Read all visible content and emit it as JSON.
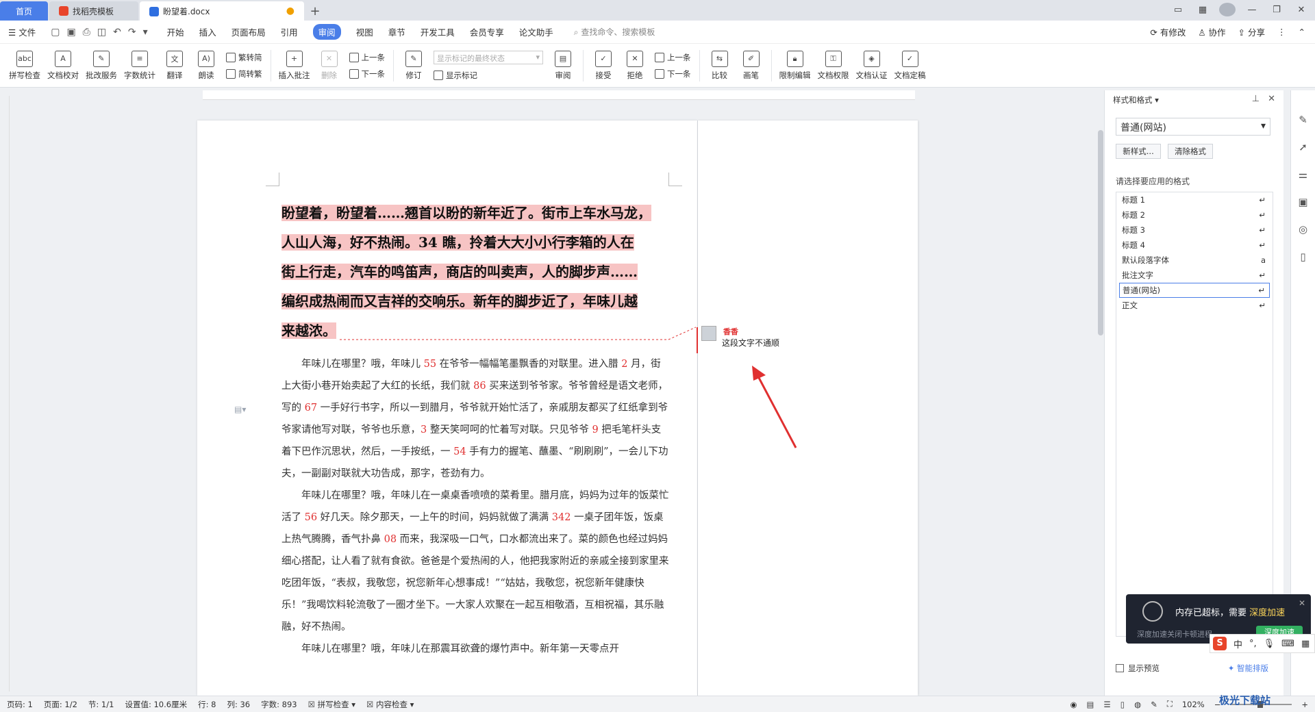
{
  "titlebar": {
    "tabs": [
      {
        "label": "首页"
      },
      {
        "label": "找稻壳模板"
      },
      {
        "label": "盼望着.docx"
      }
    ]
  },
  "menubar": {
    "file": "文件",
    "items": [
      "开始",
      "插入",
      "页面布局",
      "引用",
      "审阅",
      "视图",
      "章节",
      "开发工具",
      "会员专享",
      "论文助手"
    ],
    "active": "审阅",
    "search": "查找命令、搜索模板",
    "right": [
      "有修改",
      "协作",
      "分享"
    ]
  },
  "ribbon": {
    "spell": "拼写检查",
    "proof": "文档校对",
    "revise_service": "批改服务",
    "word_count": "字数统计",
    "translate": "翻译",
    "read_aloud": "朗读",
    "to_traditional": "繁转简",
    "to_simplified": "简转繁",
    "insert_comment": "插入批注",
    "delete": "删除",
    "prev": "上一条",
    "next": "下一条",
    "track": "修订",
    "markup_state": "显示标记的最终状态",
    "show_markup": "显示标记",
    "review": "审阅",
    "accept": "接受",
    "reject": "拒绝",
    "prev2": "上一条",
    "next2": "下一条",
    "compare": "比较",
    "ink": "画笔",
    "restrict": "限制编辑",
    "doc_perm": "文档权限",
    "doc_cert": "文档认证",
    "doc_final": "文档定稿"
  },
  "document": {
    "heading_lines": [
      "盼望着，盼望着……翘首以盼的新年近了。街市上车水马龙，",
      "人山人海，好不热闹。34 瞧，拎着大大小小行李箱的人在",
      "街上行走，汽车的鸣笛声，商店的叫卖声，人的脚步声……",
      "编织成热闹而又吉祥的交响乐。新年的脚步近了，年味儿越",
      "来越浓。"
    ],
    "paragraphs": [
      [
        {
          "t": "年味儿在哪里？哦，年味儿 "
        },
        {
          "n": "55"
        },
        {
          "t": " 在爷爷一幅幅笔墨飘香的对联里。进入腊 "
        },
        {
          "n": "2"
        },
        {
          "t": " 月，街上大街小巷开始卖起了大红的长纸，我们就 "
        },
        {
          "n": "86"
        },
        {
          "t": " 买来送到爷爷家。爷爷曾经是语文老师，写的 "
        },
        {
          "n": "67"
        },
        {
          "t": " 一手好行书字，所以一到腊月，爷爷就开始忙活了，亲戚朋友都买了红纸拿到爷爷家请他写对联，爷爷也乐意，"
        },
        {
          "n": "3"
        },
        {
          "t": " 整天笑呵呵的忙着写对联。只见爷爷 "
        },
        {
          "n": "9"
        },
        {
          "t": " 把毛笔杆头支着下巴作沉思状，然后，一手按纸，一 "
        },
        {
          "n": "54"
        },
        {
          "t": " 手有力的握笔、蘸墨、“刷刷刷”，一会儿下功夫，一副副对联就大功告成，那字，苍劲有力。"
        }
      ],
      [
        {
          "t": "年味儿在哪里？哦，年味儿在一桌桌香喷喷的菜肴里。腊月底，妈妈为过年的饭菜忙活了 "
        },
        {
          "n": "56"
        },
        {
          "t": " 好几天。除夕那天，一上午的时间，妈妈就做了满满 "
        },
        {
          "n": "342"
        },
        {
          "t": " 一桌子团年饭，饭桌上热气腾腾，香气扑鼻 "
        },
        {
          "n": "08"
        },
        {
          "t": " 而来，我深吸一口气，口水都流出来了。菜的颜色也经过妈妈细心搭配，让人看了就有食欲。爸爸是个爱热闹的人，他把我家附近的亲戚全接到家里来吃团年饭，“表叔，我敬您，祝您新年心想事成！”“姑姑，我敬您，祝您新年健康快乐！”我喝饮料轮流敬了一圈才坐下。一大家人欢聚在一起互相敬酒，互相祝福，其乐融融，好不热闹。"
        }
      ],
      [
        {
          "t": "年味儿在哪里？哦，年味儿在那震耳欲聋的爆竹声中。新年第一天零点开"
        }
      ]
    ]
  },
  "comment": {
    "author": "香香",
    "text": "这段文字不通顺"
  },
  "panel": {
    "title": "样式和格式",
    "current_style": "普通(网站)",
    "new_style": "新样式...",
    "clear_format": "清除格式",
    "choose_label": "请选择要应用的格式",
    "styles": [
      "标题 1",
      "标题 2",
      "标题 3",
      "标题 4",
      "默认段落字体",
      "批注文字",
      "普通(网站)",
      "正文"
    ],
    "selected": "普通(网站)",
    "show_preview": "显示预览",
    "smart_sort": "智能排版"
  },
  "popup": {
    "message_prefix": "内存已超标，需要 ",
    "message_highlight": "深度加速",
    "sub": "深度加速关闭卡顿进程",
    "button": "深度加速"
  },
  "statusbar": {
    "page_num": "页码: 1",
    "page": "页面: 1/2",
    "section": "节: 1/1",
    "setting": "设置值: 10.6厘米",
    "row": "行: 8",
    "col": "列: 36",
    "words": "字数: 893",
    "spell": "拼写检查",
    "content_check": "内容检查",
    "zoom": "102%"
  },
  "watermark": "极光下载站"
}
